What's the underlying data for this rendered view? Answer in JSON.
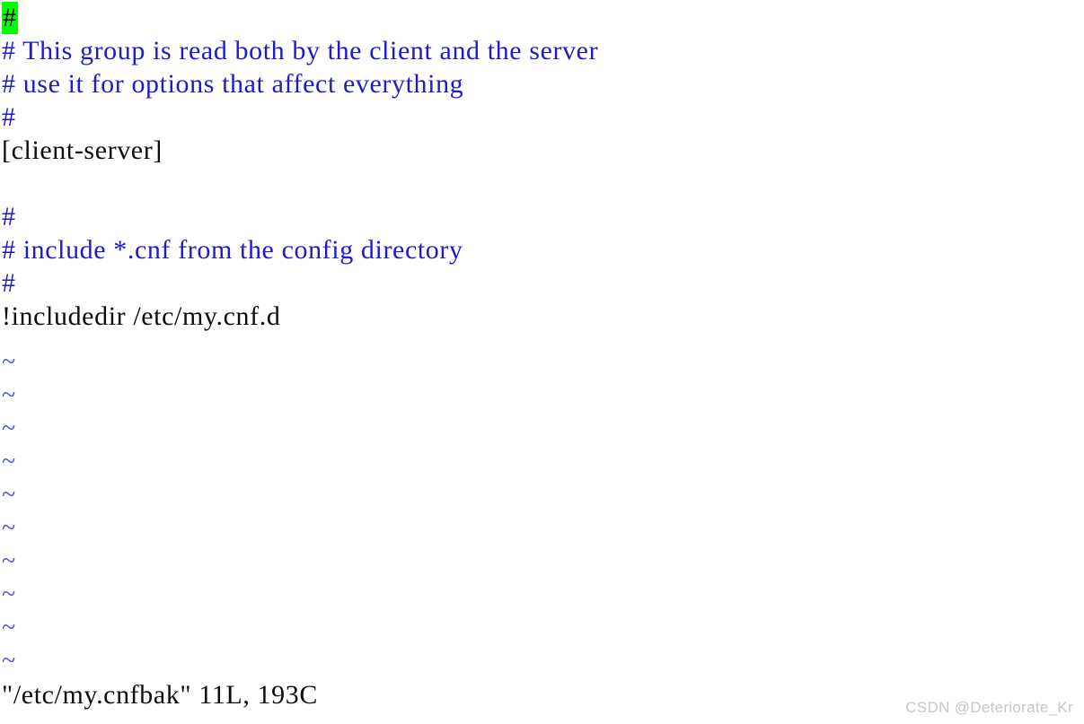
{
  "app": {
    "name": "vim",
    "mode": "normal",
    "background_color": "#ffffff"
  },
  "colors": {
    "comment": "#1c1ccd",
    "normal_text": "#0d0d0d",
    "tilde": "#4a4ae8",
    "cursor_background": "#00ff00",
    "cursor_foreground": "#000000",
    "watermark": "#c7c7c7"
  },
  "cursor": {
    "line": 1,
    "column": 1,
    "character": "#"
  },
  "editor": {
    "lines": [
      {
        "n": 1,
        "text": "#",
        "style": "comment",
        "cursor_head": "#",
        "rest": ""
      },
      {
        "n": 2,
        "text": "# This group is read both by the client and the server",
        "style": "comment"
      },
      {
        "n": 3,
        "text": "# use it for options that affect everything",
        "style": "comment"
      },
      {
        "n": 4,
        "text": "#",
        "style": "comment"
      },
      {
        "n": 5,
        "text": "[client-server]",
        "style": "normal"
      },
      {
        "n": 6,
        "text": "",
        "style": "normal"
      },
      {
        "n": 7,
        "text": "#",
        "style": "comment"
      },
      {
        "n": 8,
        "text": "# include *.cnf from the config directory",
        "style": "comment"
      },
      {
        "n": 9,
        "text": "#",
        "style": "comment"
      },
      {
        "n": 10,
        "text": "!includedir /etc/my.cnf.d",
        "style": "normal"
      }
    ],
    "filler_tildes": [
      "~",
      "~",
      "~",
      "~",
      "~",
      "~",
      "~",
      "~",
      "~",
      "~"
    ]
  },
  "statusline": {
    "text": "\"/etc/my.cnfbak\" 11L, 193C",
    "filename": "/etc/my.cnfbak",
    "line_count": "11L",
    "char_count": "193C"
  },
  "watermark": {
    "text": "CSDN @Deteriorate_Kr"
  }
}
